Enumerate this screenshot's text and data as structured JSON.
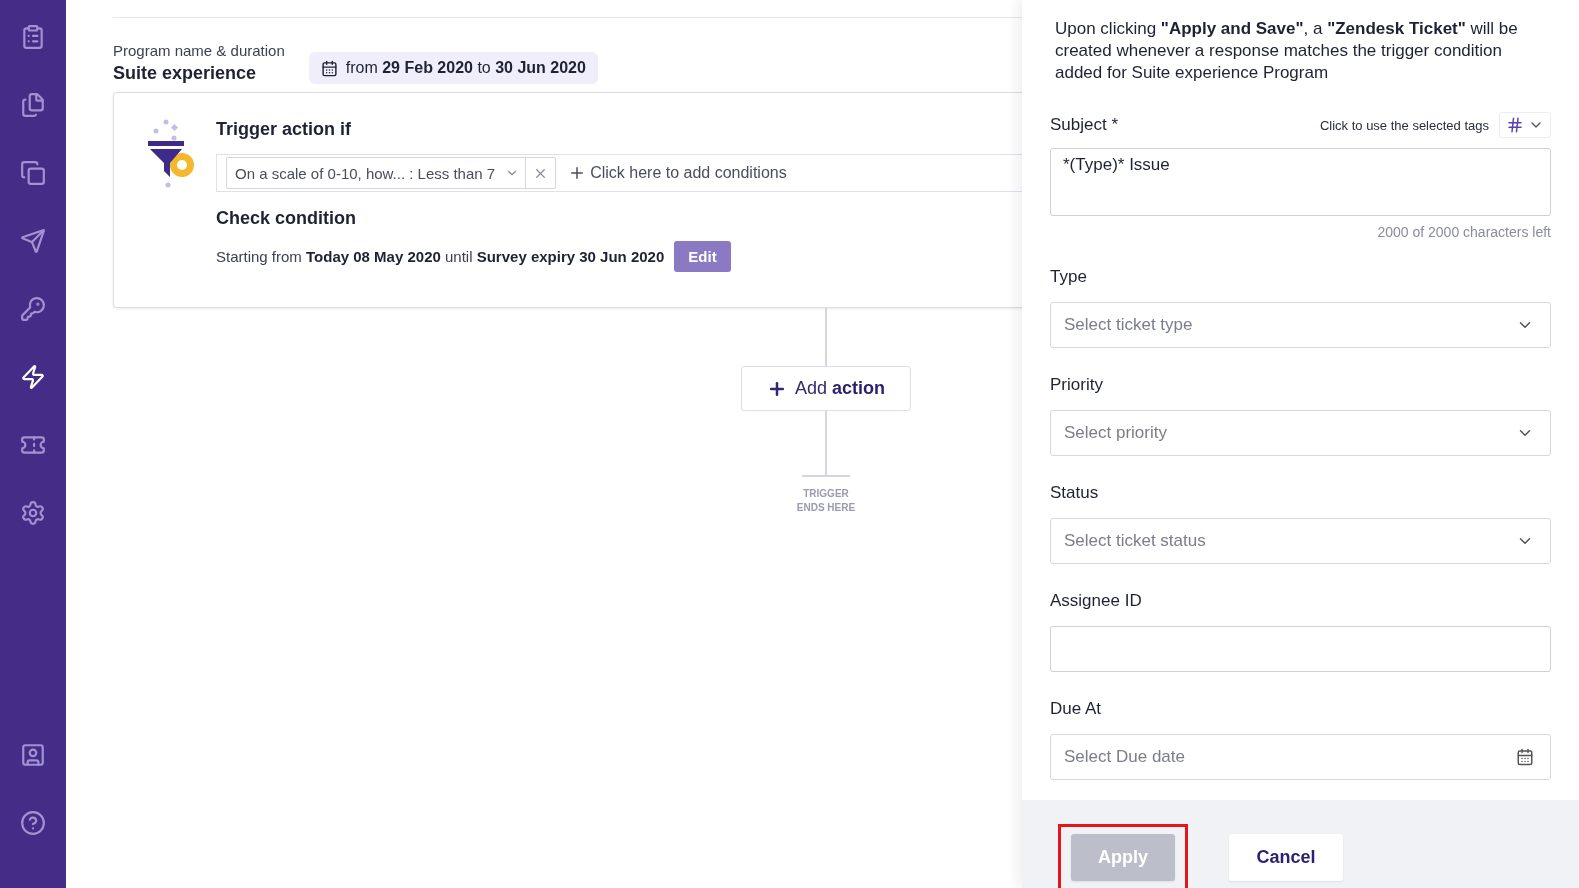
{
  "sidebar": {
    "items": [
      {
        "selected": false
      },
      {
        "selected": false
      },
      {
        "selected": false
      },
      {
        "selected": false
      },
      {
        "selected": false
      },
      {
        "selected": true
      },
      {
        "selected": false
      },
      {
        "selected": false
      }
    ],
    "bottom_items": [
      {
        "selected": false
      },
      {
        "selected": false
      }
    ]
  },
  "program": {
    "label": "Program name & duration",
    "name": "Suite experience",
    "duration": "from **29 Feb 2020** to **30 Jun 2020**"
  },
  "trigger": {
    "title": "Trigger action if",
    "condition": "On a scale of 0-10, how... : Less than 7",
    "add_condition": "Click here to add conditions",
    "check_title": "Check condition",
    "check_text": "Starting from **Today 08 May 2020** until **Survey expiry 30 Jun 2020**",
    "edit_button": "Edit"
  },
  "flow": {
    "add_action": "Add **action**",
    "end_label": "TRIGGER ENDS HERE"
  },
  "panel": {
    "intro": "Upon clicking **\"Apply and Save\"**, a **\"Zendesk Ticket\"** will be created whenever a response matches the trigger condition added for Suite experience Program",
    "fields": [
      {
        "kind": "textarea",
        "label": "Subject *",
        "tags_hint": "Click to use the selected tags",
        "value": "*(Type)* Issue",
        "counter": "2000 of 2000 characters left"
      },
      {
        "kind": "select",
        "label": "Type",
        "placeholder": "Select ticket type"
      },
      {
        "kind": "select",
        "label": "Priority",
        "placeholder": "Select priority"
      },
      {
        "kind": "select",
        "label": "Status",
        "placeholder": "Select ticket status"
      },
      {
        "kind": "text",
        "label": "Assignee ID"
      },
      {
        "kind": "date",
        "label": "Due At",
        "placeholder": "Select Due date"
      }
    ],
    "buttons": [
      {
        "label": "Apply",
        "disabled": true,
        "highlighted": true
      },
      {
        "label": "Cancel",
        "disabled": false,
        "highlighted": false
      }
    ]
  }
}
